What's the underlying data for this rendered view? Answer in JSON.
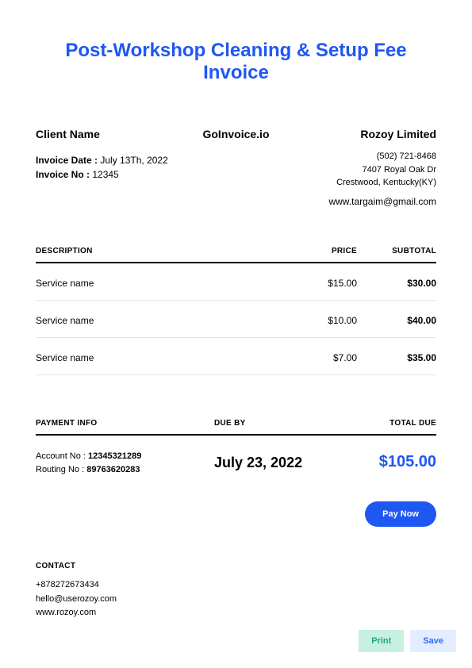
{
  "title": "Post-Workshop Cleaning & Setup Fee Invoice",
  "brand": "GoInvoice.io",
  "client_label": "Client Name",
  "invoice_date_label": "Invoice Date :",
  "invoice_date": "July 13Th, 2022",
  "invoice_no_label": "Invoice No :",
  "invoice_no": "12345",
  "company": {
    "name": "Rozoy Limited",
    "phone": "(502) 721-8468",
    "address1": "7407 Royal Oak Dr",
    "address2": "Crestwood, Kentucky(KY)",
    "site": "www.targaim@gmail.com"
  },
  "table": {
    "headers": {
      "desc": "DESCRIPTION",
      "price": "PRICE",
      "subtotal": "SUBTOTAL"
    },
    "rows": [
      {
        "desc": "Service name",
        "price": "$15.00",
        "subtotal": "$30.00"
      },
      {
        "desc": "Service name",
        "price": "$10.00",
        "subtotal": "$40.00"
      },
      {
        "desc": "Service name",
        "price": "$7.00",
        "subtotal": "$35.00"
      }
    ]
  },
  "payment": {
    "headers": {
      "info": "PAYMENT INFO",
      "due": "DUE BY",
      "total": "TOTAL DUE"
    },
    "account_label": "Account No :",
    "account": "12345321289",
    "routing_label": "Routing No :",
    "routing": "89763620283",
    "due_by": "July 23, 2022",
    "total_due": "$105.00",
    "pay_now": "Pay Now"
  },
  "contact": {
    "header": "CONTACT",
    "phone": "+878272673434",
    "email": "hello@userozoy.com",
    "site": "www.rozoy.com"
  },
  "actions": {
    "print": "Print",
    "save": "Save"
  }
}
